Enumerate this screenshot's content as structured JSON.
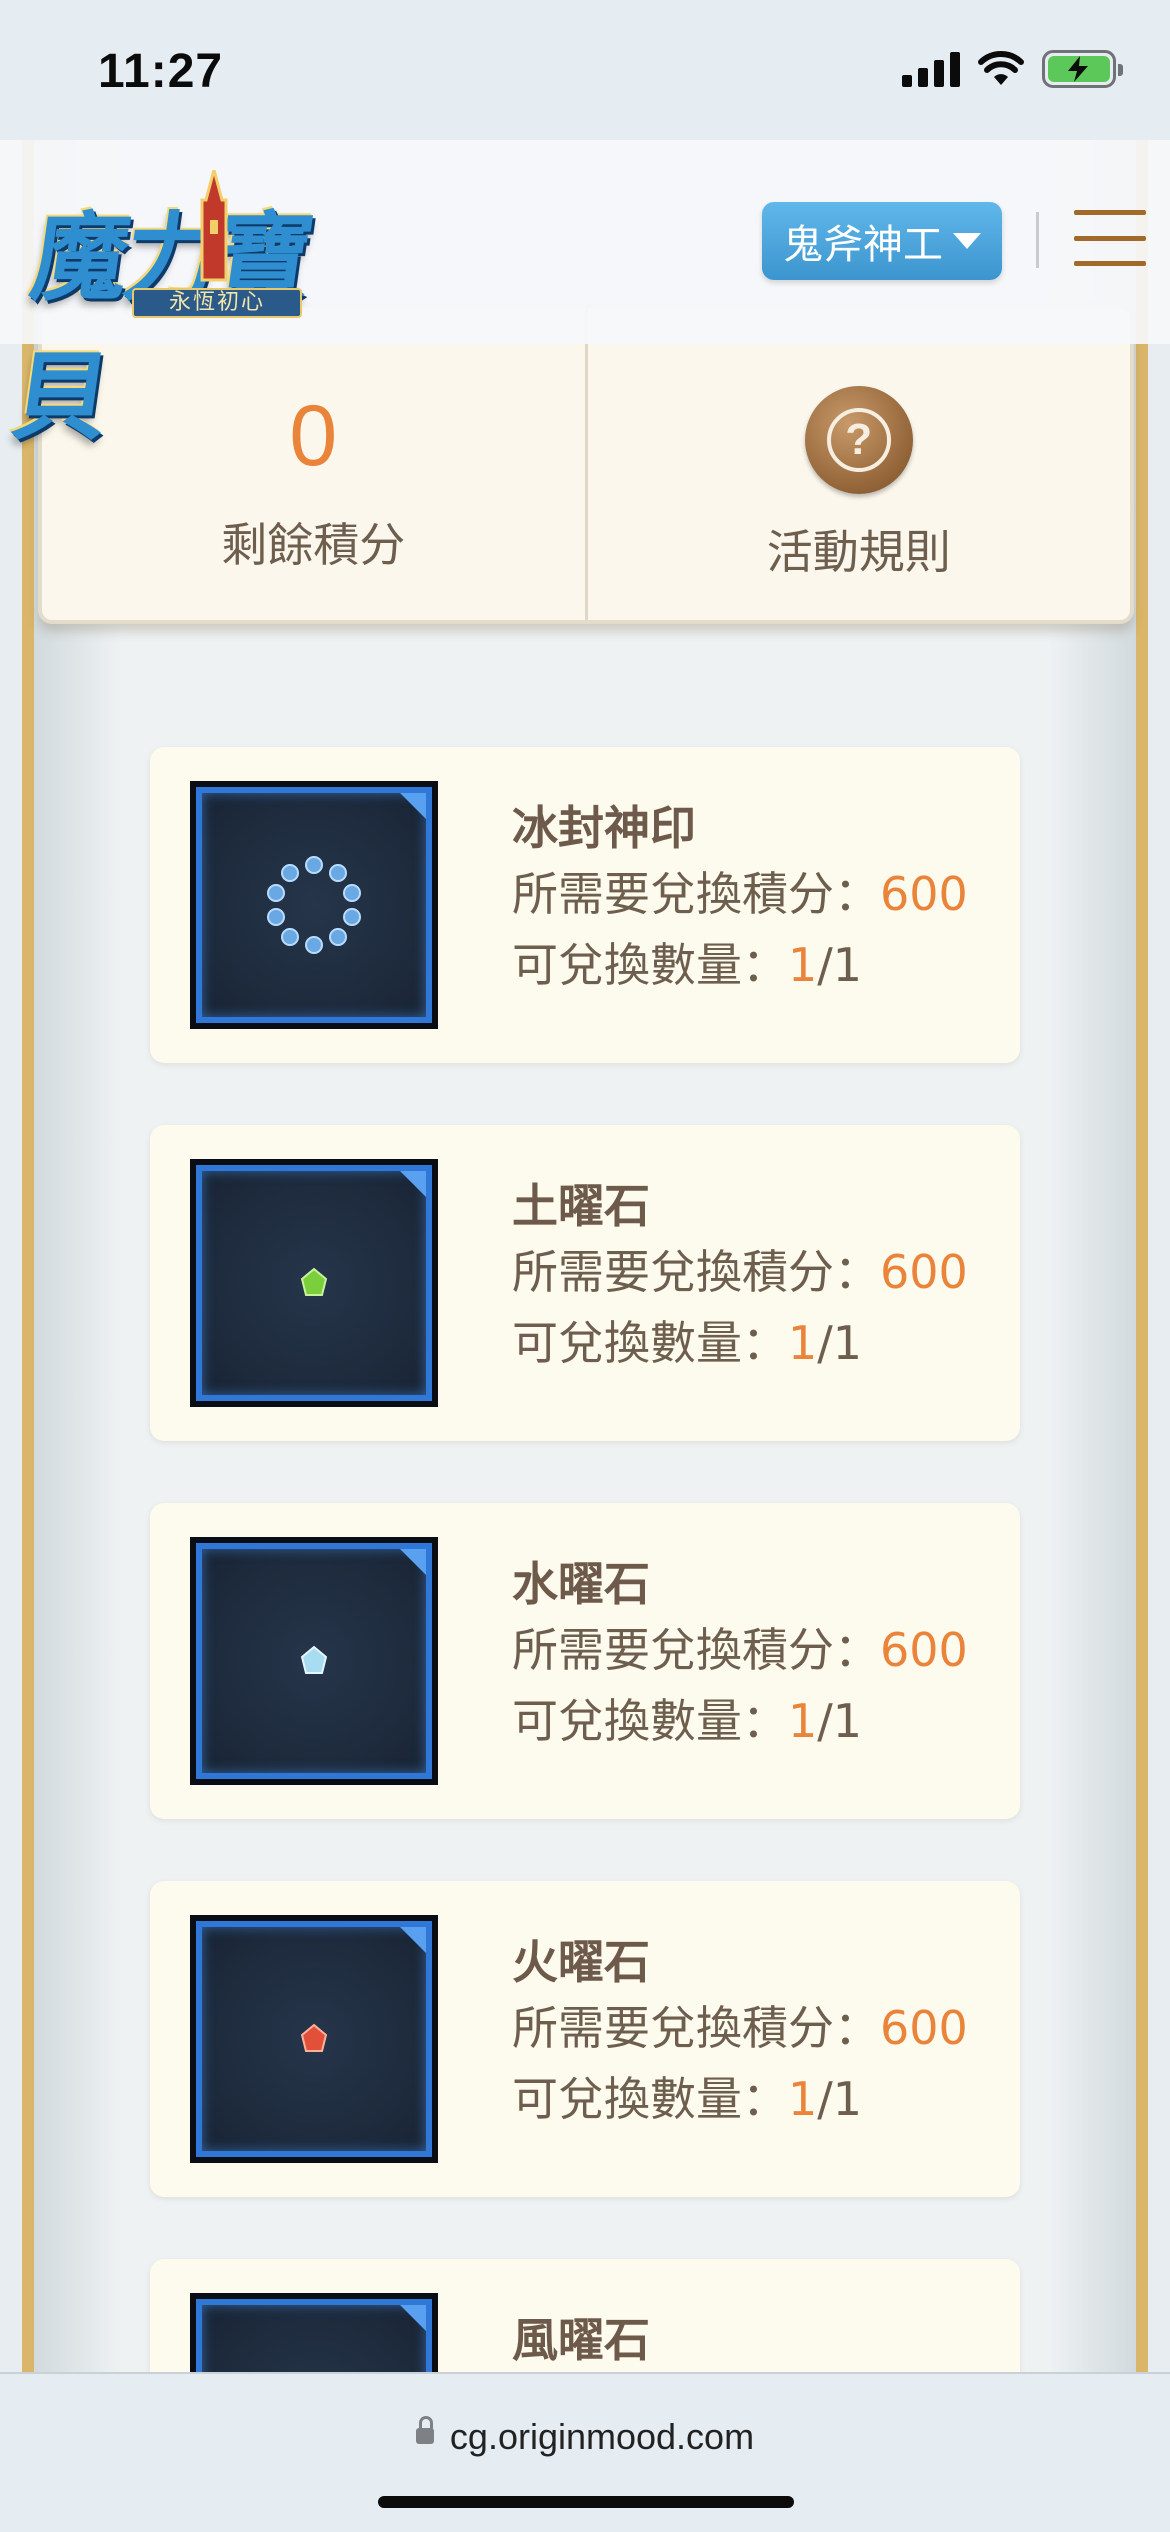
{
  "status_bar": {
    "time": "11:27"
  },
  "header": {
    "logo_text": "魔力寶貝",
    "logo_subtitle": "永恆初心",
    "server_select": "鬼斧神工"
  },
  "points_panel": {
    "remaining_points": "0",
    "remaining_label": "剩餘積分",
    "rules_label": "活動規則"
  },
  "labels": {
    "cost_prefix": "所需要兌換積分：",
    "qty_prefix": "可兌換數量："
  },
  "items": [
    {
      "name": "冰封神印",
      "cost": "600",
      "qty_current": "1",
      "qty_total": "/1",
      "icon": "ice-seal-ring-icon"
    },
    {
      "name": "土曜石",
      "cost": "600",
      "qty_current": "1",
      "qty_total": "/1",
      "icon": "green-gem-icon",
      "gem_color": "#7ccf3c"
    },
    {
      "name": "水曜石",
      "cost": "600",
      "qty_current": "1",
      "qty_total": "/1",
      "icon": "blue-gem-icon",
      "gem_color": "#a8dcf0"
    },
    {
      "name": "火曜石",
      "cost": "600",
      "qty_current": "1",
      "qty_total": "/1",
      "icon": "red-gem-icon",
      "gem_color": "#e2503a"
    },
    {
      "name": "風曜石",
      "icon": "wind-gem-icon"
    }
  ],
  "browser": {
    "url": "cg.originmood.com"
  },
  "colors": {
    "accent_orange": "#e9843a",
    "server_blue": "#4aa4dc",
    "frame_gold": "#d9b66a"
  }
}
